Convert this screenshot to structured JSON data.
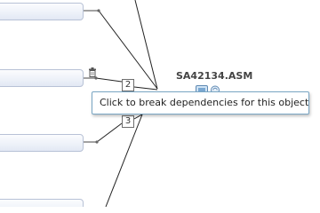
{
  "diagram": {
    "object_title": "SA42134.ASM",
    "connector_labels": [
      "2",
      "3"
    ],
    "tooltip_text": "Click to break dependencies for this object."
  },
  "icons": {
    "trash": "trash-icon",
    "object_type": "object-type-icon",
    "object_info": "object-info-icon"
  },
  "colors": {
    "node_border": "#b8c2d6",
    "node_fill": "#eef2f9",
    "line": "#222222",
    "tooltip_border": "#79a6c4"
  }
}
